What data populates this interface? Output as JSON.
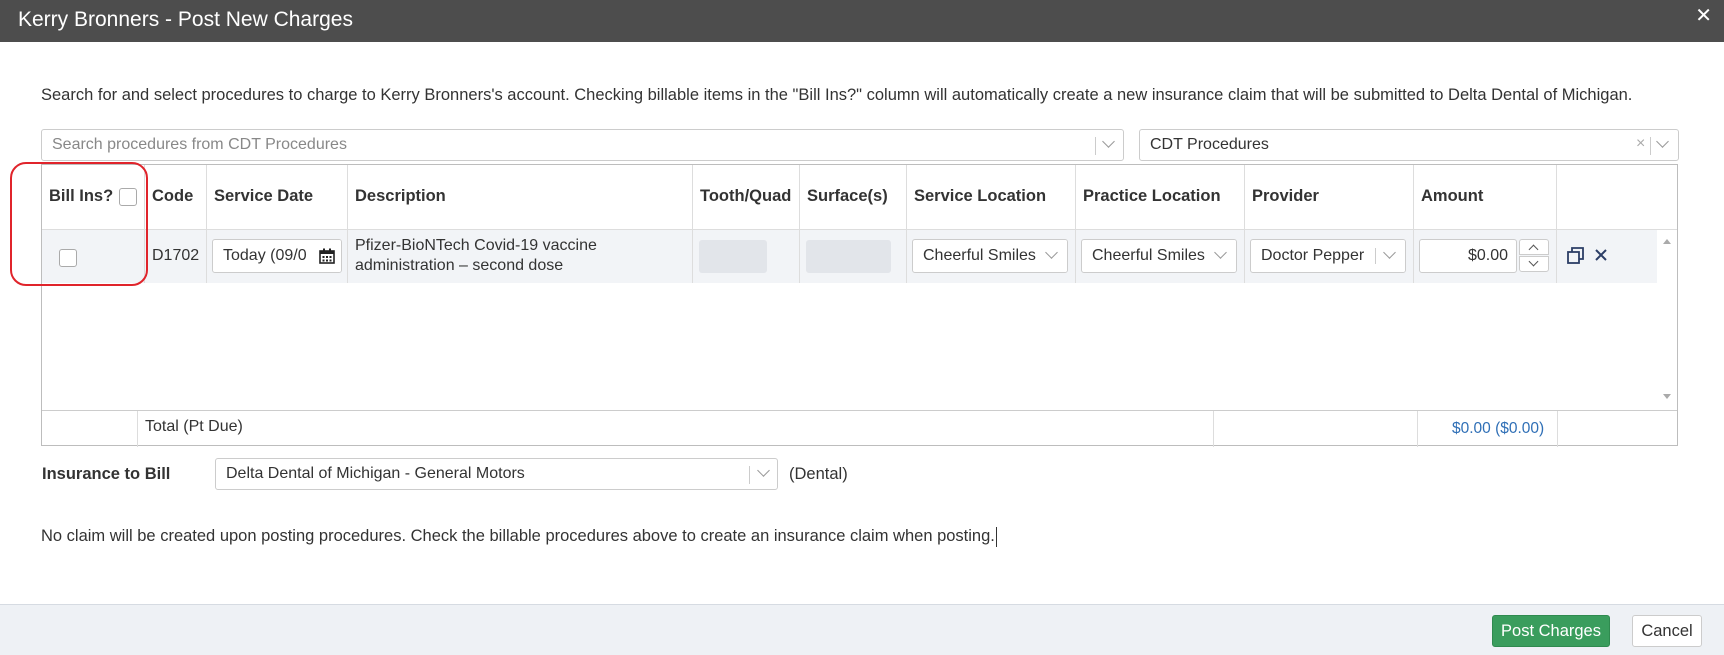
{
  "dialog": {
    "title": "Kerry Bronners - Post New Charges",
    "close_glyph": "✕",
    "intro": "Search for and select procedures to charge to Kerry Bronners's account. Checking billable items in the \"Bill Ins?\" column will automatically create a new insurance claim that will be submitted to Delta Dental of Michigan."
  },
  "search": {
    "placeholder": "Search procedures from CDT Procedures",
    "codeset_value": "CDT Procedures",
    "clear_glyph": "×"
  },
  "table": {
    "headers": {
      "bill_ins": "Bill Ins?",
      "code": "Code",
      "service_date": "Service Date",
      "description": "Description",
      "tooth_quad": "Tooth/Quad",
      "surfaces": "Surface(s)",
      "service_location": "Service Location",
      "practice_location": "Practice Location",
      "provider": "Provider",
      "amount": "Amount"
    },
    "rows": [
      {
        "bill_ins_checked": false,
        "code": "D1702",
        "service_date": "Today (09/0",
        "description_line1": "Pfizer-BioNTech Covid-19 vaccine",
        "description_line2": "administration – second dose",
        "tooth_quad": "",
        "surfaces": "",
        "service_location": "Cheerful Smiles",
        "practice_location": "Cheerful Smiles",
        "provider": "Doctor Pepper",
        "amount": "$0.00"
      }
    ],
    "total_label": "Total (Pt Due)",
    "total_value": "$0.00 ($0.00)"
  },
  "insurance": {
    "label": "Insurance to Bill",
    "selected": "Delta Dental of Michigan - General Motors",
    "type": "(Dental)"
  },
  "note": "No claim will be created upon posting procedures. Check the billable procedures above to create an insurance claim when posting.",
  "footer": {
    "post_label": "Post Charges",
    "cancel_label": "Cancel"
  },
  "colors": {
    "titlebar": "#4d4d4d",
    "primary_button": "#3a9d5d",
    "annotation": "#e0242b",
    "link": "#2f6fb6"
  }
}
